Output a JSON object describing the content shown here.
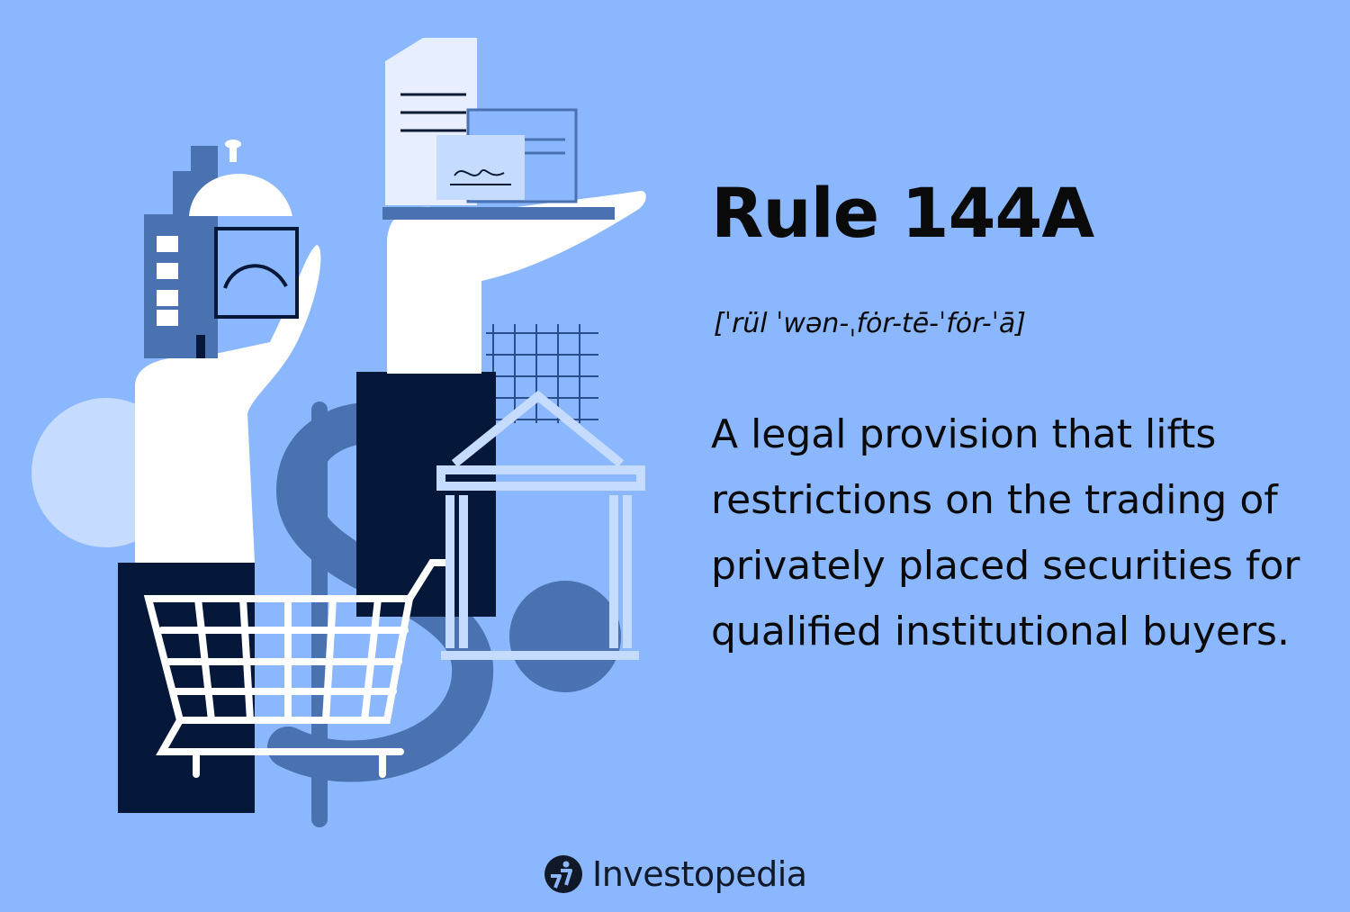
{
  "palette": {
    "background": "#8BB7FE",
    "navy": "#06183A",
    "mid_blue": "#4A72B0",
    "light_blue": "#C5DBFF",
    "white": "#FFFFFF",
    "text": "#0A0A0A"
  },
  "term": {
    "title": "Rule 144A",
    "pronunciation": "[ˈrül ˈwən-ˌfȯr-tē-ˈfȯr-ˈā]",
    "definition": "A legal provision that lifts restrictions on the trading of privately placed securities for qualified institutional buyers."
  },
  "brand": {
    "logo_icon": "investopedia-logo-icon",
    "name": "Investopedia"
  },
  "illustration": {
    "elements": [
      "hand-holding-building-and-cash",
      "hand-holding-documents",
      "shopping-cart",
      "dollar-sign",
      "bank-building",
      "grid",
      "circles"
    ]
  }
}
